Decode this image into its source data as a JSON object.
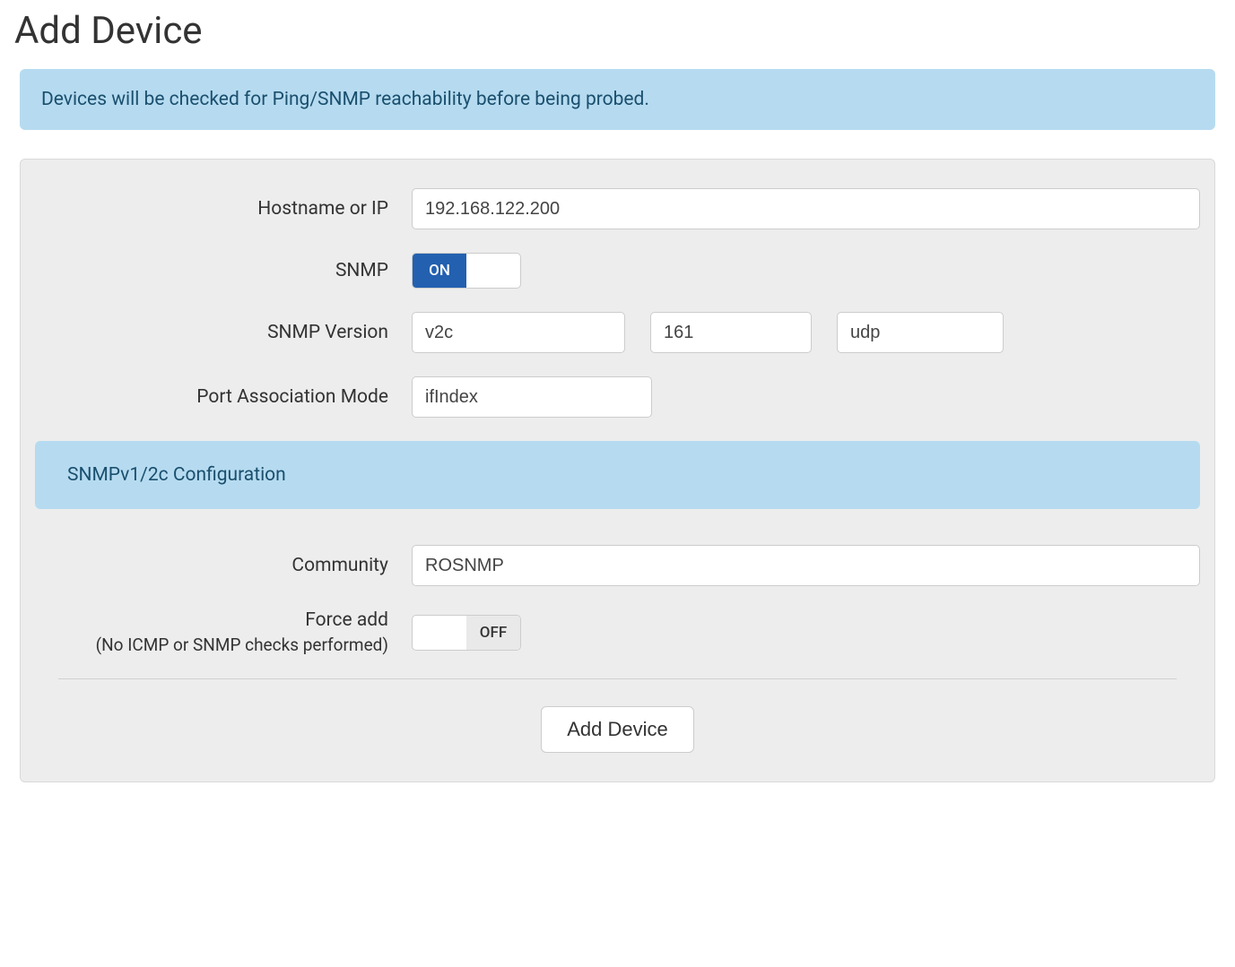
{
  "page": {
    "title": "Add Device",
    "info_banner": "Devices will be checked for Ping/SNMP reachability before being probed."
  },
  "form": {
    "hostname": {
      "label": "Hostname or IP",
      "value": "192.168.122.200"
    },
    "snmp": {
      "label": "SNMP",
      "state": "ON"
    },
    "snmp_version": {
      "label": "SNMP Version",
      "version_value": "v2c",
      "port_value": "161",
      "transport_value": "udp"
    },
    "port_assoc": {
      "label": "Port Association Mode",
      "value": "ifIndex"
    },
    "section_header": "SNMPv1/2c Configuration",
    "community": {
      "label": "Community",
      "value": "ROSNMP"
    },
    "force_add": {
      "label": "Force add",
      "sublabel": "(No ICMP or SNMP checks performed)",
      "state": "OFF"
    },
    "submit_label": "Add Device"
  }
}
